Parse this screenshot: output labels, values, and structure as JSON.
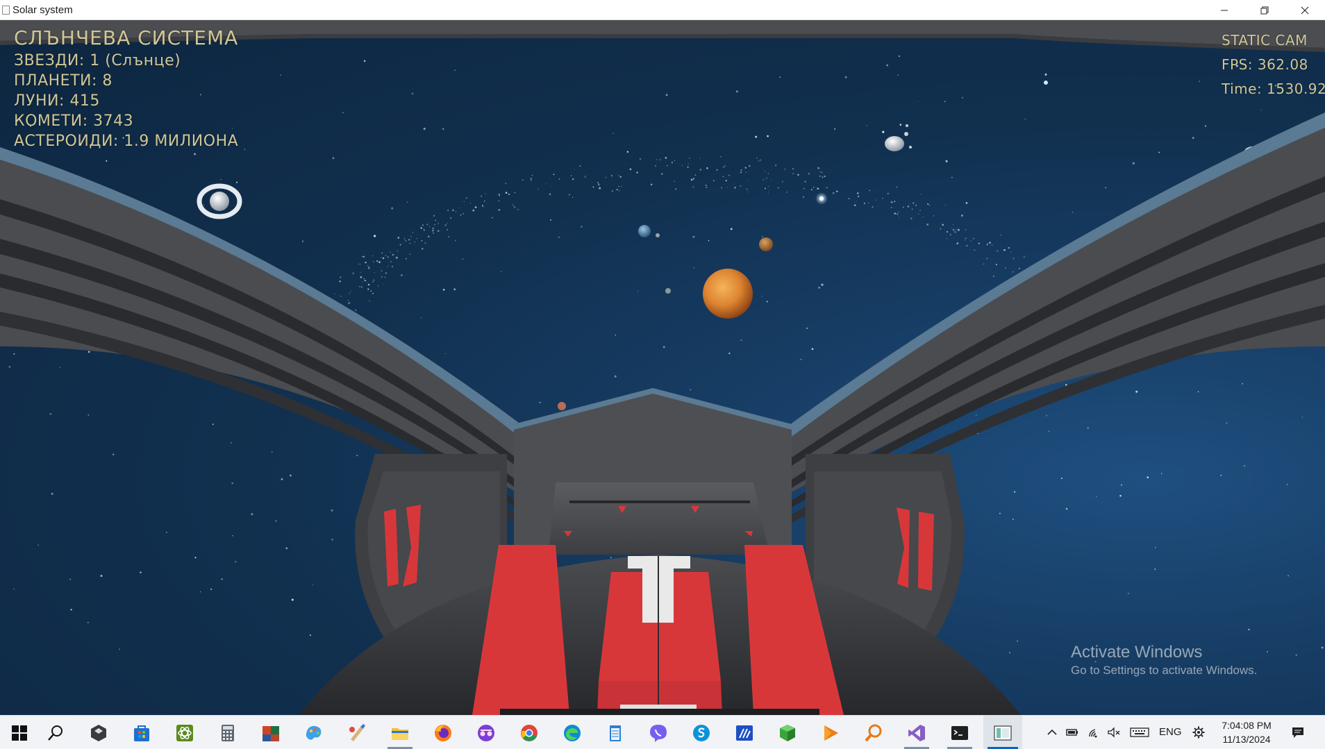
{
  "window": {
    "title": "Solar system",
    "controls": {
      "minimize_icon": "minimize-icon",
      "restore_icon": "restore-icon",
      "close_icon": "close-icon"
    }
  },
  "hud": {
    "title": "СЛЪНЧЕВА СИСТЕМА",
    "lines": [
      "ЗВЕЗДИ: 1 (Слънце)",
      "ПЛАНЕТИ: 8",
      "ЛУНИ: 415",
      "КОМЕТИ: 3743",
      "АСТЕРОИДИ: 1.9 МИЛИОНА"
    ],
    "camera_mode": "STATIC CAM",
    "fps": "FPS: 362.08",
    "time": "Time: 1530.92"
  },
  "watermark": {
    "title": "Activate Windows",
    "subtitle": "Go to Settings to activate Windows."
  },
  "colors": {
    "hud_text": "#d1c796",
    "space_background": "#11304f",
    "cockpit_red": "#d8373a",
    "cockpit_gray": "#4b4d51",
    "taskbar": "#f2f3f6",
    "accent": "#0a64c8"
  },
  "taskbar": {
    "items": [
      {
        "icon": "windows-start-icon"
      },
      {
        "icon": "search-icon"
      },
      {
        "icon": "unity-icon"
      },
      {
        "icon": "microsoft-store-icon"
      },
      {
        "icon": "atom-app-icon"
      },
      {
        "icon": "calculator-icon"
      },
      {
        "icon": "office-apps-icon"
      },
      {
        "icon": "paint-3d-icon"
      },
      {
        "icon": "paint-brush-icon"
      },
      {
        "icon": "file-explorer-icon"
      },
      {
        "icon": "firefox-icon"
      },
      {
        "icon": "incognito-browser-icon"
      },
      {
        "icon": "chrome-icon"
      },
      {
        "icon": "edge-icon"
      },
      {
        "icon": "notepad-icon"
      },
      {
        "icon": "viber-icon"
      },
      {
        "icon": "skype-icon"
      },
      {
        "icon": "math-app-icon"
      },
      {
        "icon": "green-cube-icon"
      },
      {
        "icon": "media-player-icon"
      },
      {
        "icon": "magnifier-icon"
      },
      {
        "icon": "visual-studio-icon"
      },
      {
        "icon": "terminal-icon"
      },
      {
        "icon": "solar-system-app-icon"
      }
    ],
    "tray": {
      "language": "ENG",
      "time": "7:04:08 PM",
      "date": "11/13/2024"
    }
  }
}
